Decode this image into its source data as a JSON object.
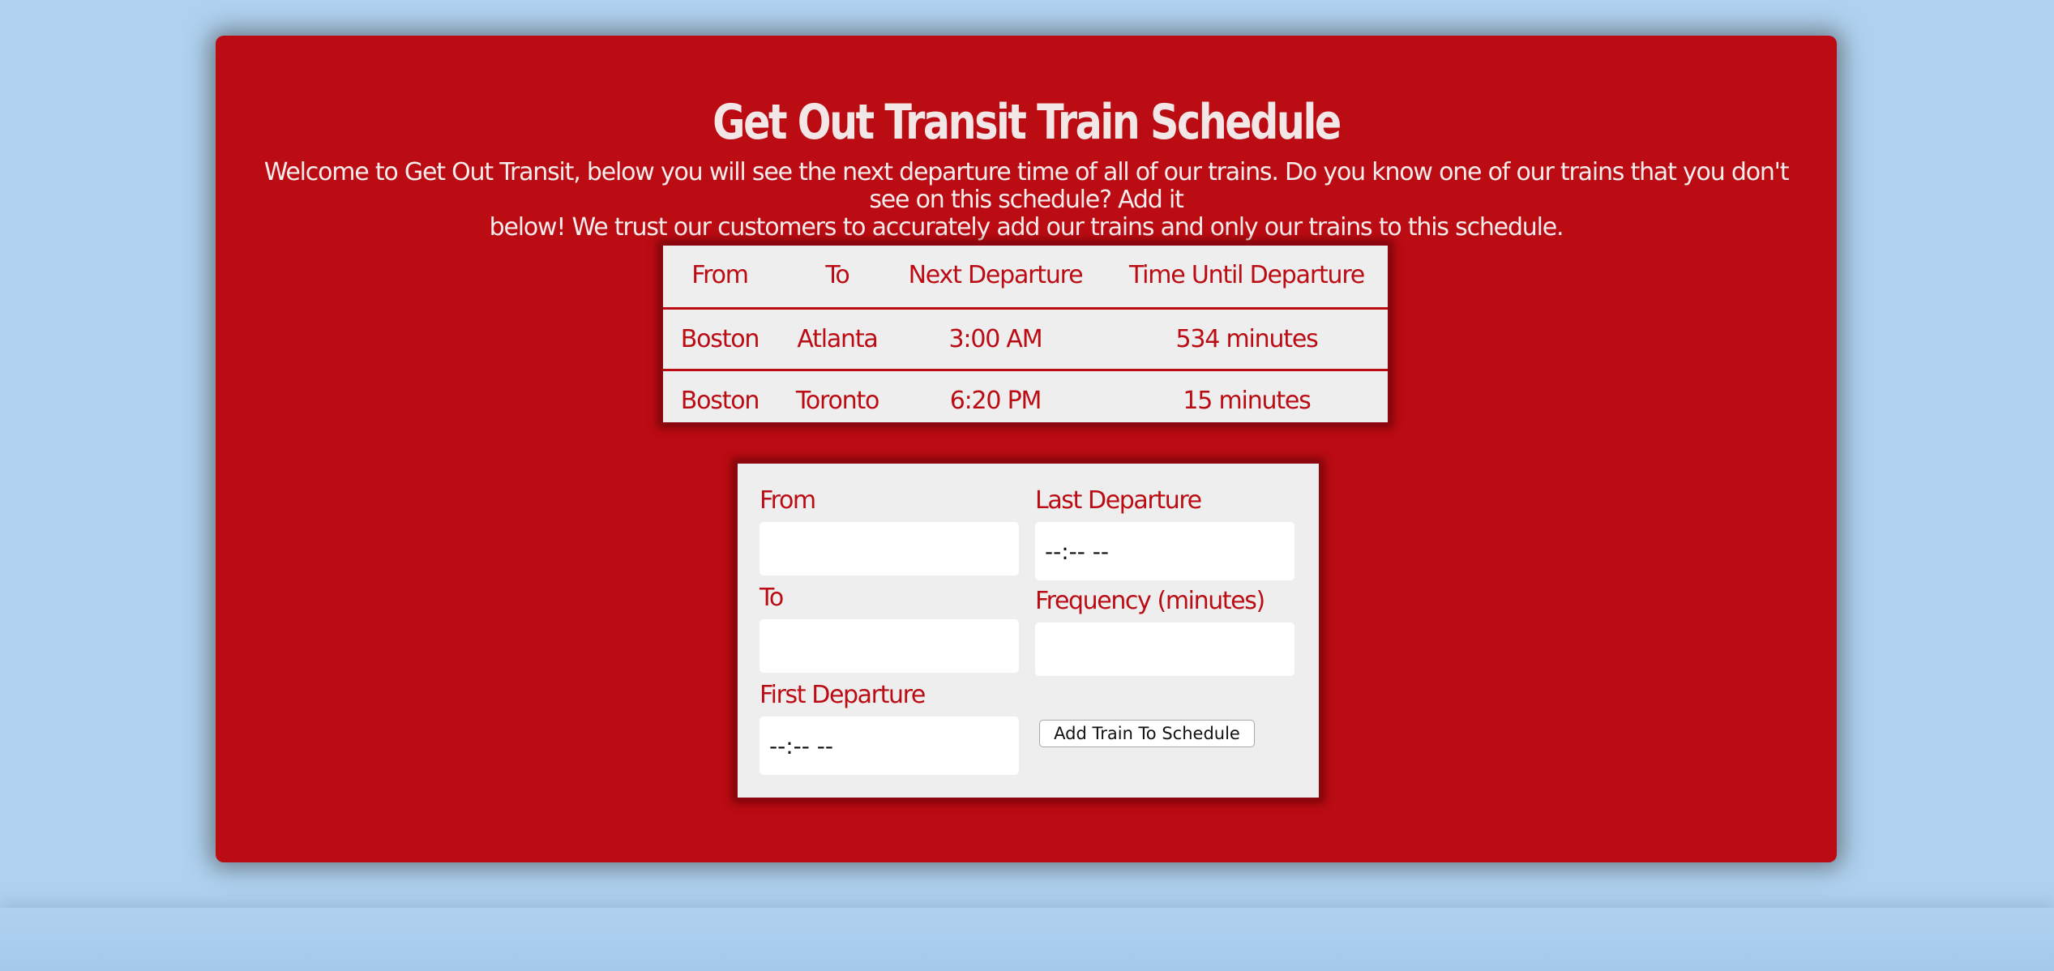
{
  "page": {
    "title": "Get Out Transit Train Schedule",
    "intro_line1": "Welcome to Get Out Transit, below you will see the next departure time of all of our trains. Do you know one of our trains that you don't see on this schedule? Add it",
    "intro_line2": "below! We trust our customers to accurately add our trains and only our trains to this schedule."
  },
  "schedule": {
    "headers": [
      "From",
      "To",
      "Next Departure",
      "Time Until Departure"
    ],
    "rows": [
      [
        "Boston",
        "Atlanta",
        "3:00 AM",
        "534 minutes"
      ],
      [
        "Boston",
        "Toronto",
        "6:20 PM",
        "15 minutes"
      ]
    ]
  },
  "form": {
    "from_label": "From",
    "from_value": "",
    "to_label": "To",
    "to_value": "",
    "first_departure_label": "First Departure",
    "first_departure_placeholder": "--:-- --",
    "last_departure_label": "Last Departure",
    "last_departure_placeholder": "--:-- --",
    "frequency_label": "Frequency (minutes)",
    "frequency_value": "",
    "submit_label": "Add Train To Schedule"
  },
  "colors": {
    "background": "#afd2f0",
    "panel": "#bb0b13",
    "card": "#eeeeef",
    "heading_text": "#f3e6e6"
  }
}
